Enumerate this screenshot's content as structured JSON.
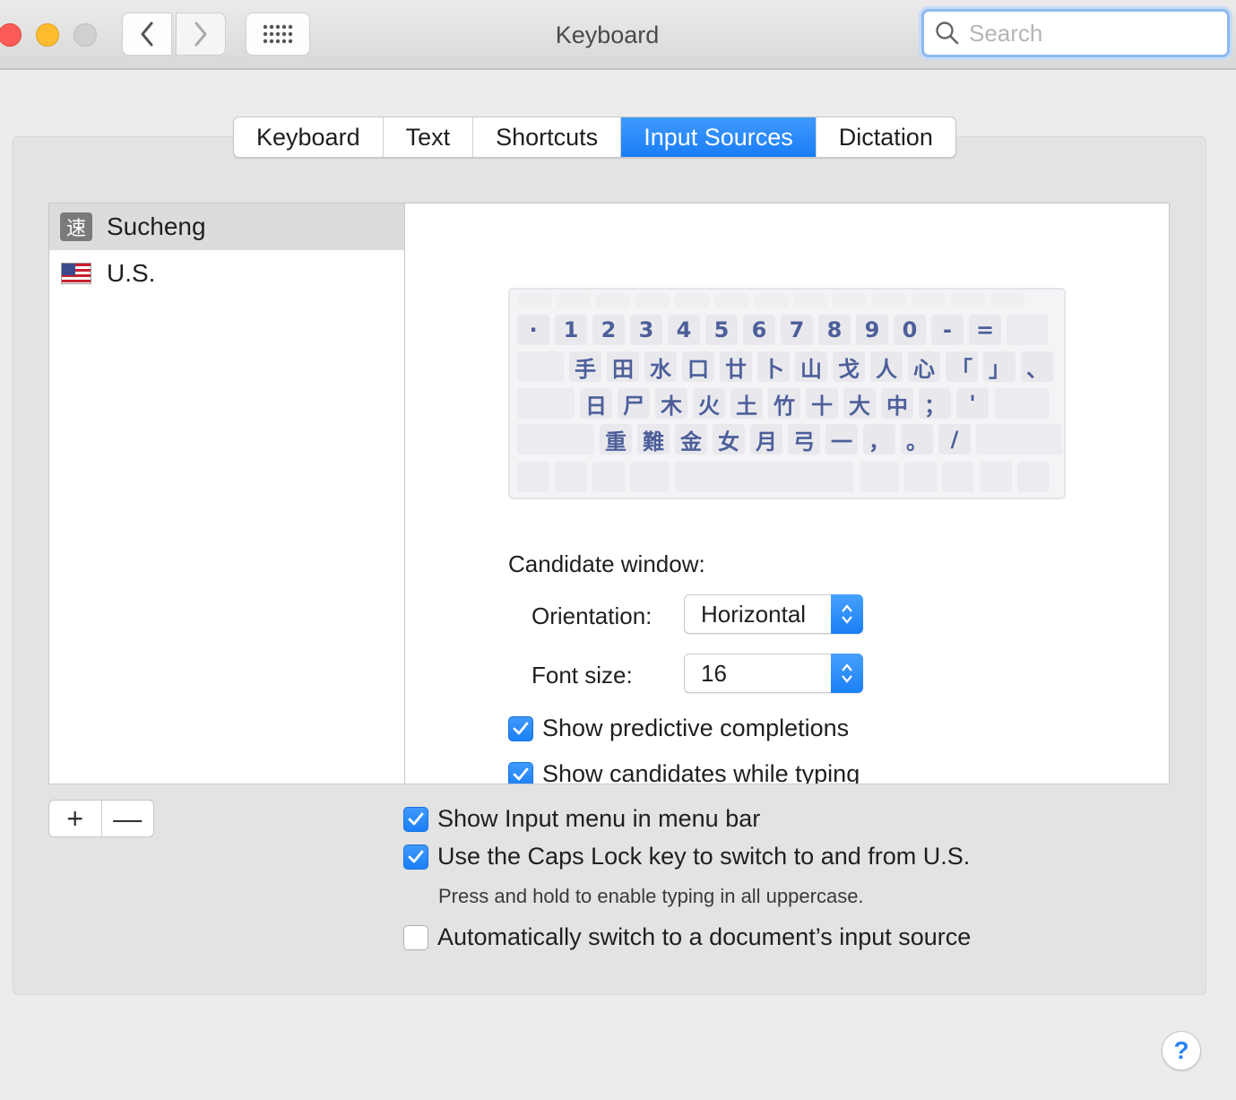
{
  "window": {
    "title": "Keyboard"
  },
  "toolbar": {
    "back_icon": "chevron-left-icon",
    "forward_icon": "chevron-right-icon",
    "grid_icon": "grid-icon",
    "search_placeholder": "Search"
  },
  "tabs": [
    {
      "label": "Keyboard",
      "active": false
    },
    {
      "label": "Text",
      "active": false
    },
    {
      "label": "Shortcuts",
      "active": false
    },
    {
      "label": "Input Sources",
      "active": true
    },
    {
      "label": "Dictation",
      "active": false
    }
  ],
  "sources": [
    {
      "label": "Sucheng",
      "icon": "速",
      "selected": true
    },
    {
      "label": "U.S.",
      "icon": "us-flag-icon",
      "selected": false
    }
  ],
  "keyboard_layout": {
    "row1": [
      "·",
      "1",
      "2",
      "3",
      "4",
      "5",
      "6",
      "7",
      "8",
      "9",
      "0",
      "-",
      "="
    ],
    "row2": [
      "手",
      "田",
      "水",
      "口",
      "廿",
      "卜",
      "山",
      "戈",
      "人",
      "心",
      "「",
      "」",
      "、"
    ],
    "row3": [
      "日",
      "尸",
      "木",
      "火",
      "土",
      "竹",
      "十",
      "大",
      "中",
      "；",
      "'"
    ],
    "row4": [
      "重",
      "難",
      "金",
      "女",
      "月",
      "弓",
      "一",
      "，",
      "。",
      "/"
    ]
  },
  "candidate": {
    "heading": "Candidate window:",
    "orientation_label": "Orientation:",
    "orientation_value": "Horizontal",
    "font_size_label": "Font size:",
    "font_size_value": "16",
    "predictive_label": "Show predictive completions",
    "predictive_checked": true,
    "candidates_label": "Show candidates while typing",
    "candidates_checked": true
  },
  "options": {
    "input_menu_label": "Show Input menu in menu bar",
    "caps_lock_label": "Use the Caps Lock key to switch to and from U.S.",
    "caps_lock_hint": "Press and hold to enable typing in all uppercase.",
    "auto_switch_label": "Automatically switch to a document’s input source"
  },
  "list_buttons": {
    "add": "+",
    "remove": "—"
  },
  "help": "?",
  "colors": {
    "accent": "#1a7df7",
    "key_text": "#4d5f9a",
    "close": "#fc5b57",
    "minimize": "#fdbc2e"
  }
}
